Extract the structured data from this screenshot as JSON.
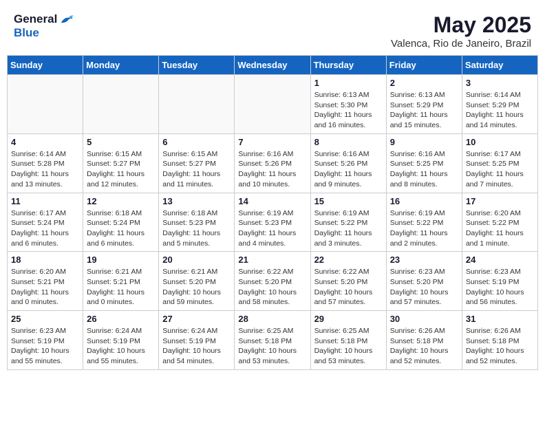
{
  "header": {
    "logo_general": "General",
    "logo_blue": "Blue",
    "month_title": "May 2025",
    "location": "Valenca, Rio de Janeiro, Brazil"
  },
  "weekdays": [
    "Sunday",
    "Monday",
    "Tuesday",
    "Wednesday",
    "Thursday",
    "Friday",
    "Saturday"
  ],
  "weeks": [
    [
      {
        "day": "",
        "info": ""
      },
      {
        "day": "",
        "info": ""
      },
      {
        "day": "",
        "info": ""
      },
      {
        "day": "",
        "info": ""
      },
      {
        "day": "1",
        "info": "Sunrise: 6:13 AM\nSunset: 5:30 PM\nDaylight: 11 hours\nand 16 minutes."
      },
      {
        "day": "2",
        "info": "Sunrise: 6:13 AM\nSunset: 5:29 PM\nDaylight: 11 hours\nand 15 minutes."
      },
      {
        "day": "3",
        "info": "Sunrise: 6:14 AM\nSunset: 5:29 PM\nDaylight: 11 hours\nand 14 minutes."
      }
    ],
    [
      {
        "day": "4",
        "info": "Sunrise: 6:14 AM\nSunset: 5:28 PM\nDaylight: 11 hours\nand 13 minutes."
      },
      {
        "day": "5",
        "info": "Sunrise: 6:15 AM\nSunset: 5:27 PM\nDaylight: 11 hours\nand 12 minutes."
      },
      {
        "day": "6",
        "info": "Sunrise: 6:15 AM\nSunset: 5:27 PM\nDaylight: 11 hours\nand 11 minutes."
      },
      {
        "day": "7",
        "info": "Sunrise: 6:16 AM\nSunset: 5:26 PM\nDaylight: 11 hours\nand 10 minutes."
      },
      {
        "day": "8",
        "info": "Sunrise: 6:16 AM\nSunset: 5:26 PM\nDaylight: 11 hours\nand 9 minutes."
      },
      {
        "day": "9",
        "info": "Sunrise: 6:16 AM\nSunset: 5:25 PM\nDaylight: 11 hours\nand 8 minutes."
      },
      {
        "day": "10",
        "info": "Sunrise: 6:17 AM\nSunset: 5:25 PM\nDaylight: 11 hours\nand 7 minutes."
      }
    ],
    [
      {
        "day": "11",
        "info": "Sunrise: 6:17 AM\nSunset: 5:24 PM\nDaylight: 11 hours\nand 6 minutes."
      },
      {
        "day": "12",
        "info": "Sunrise: 6:18 AM\nSunset: 5:24 PM\nDaylight: 11 hours\nand 6 minutes."
      },
      {
        "day": "13",
        "info": "Sunrise: 6:18 AM\nSunset: 5:23 PM\nDaylight: 11 hours\nand 5 minutes."
      },
      {
        "day": "14",
        "info": "Sunrise: 6:19 AM\nSunset: 5:23 PM\nDaylight: 11 hours\nand 4 minutes."
      },
      {
        "day": "15",
        "info": "Sunrise: 6:19 AM\nSunset: 5:22 PM\nDaylight: 11 hours\nand 3 minutes."
      },
      {
        "day": "16",
        "info": "Sunrise: 6:19 AM\nSunset: 5:22 PM\nDaylight: 11 hours\nand 2 minutes."
      },
      {
        "day": "17",
        "info": "Sunrise: 6:20 AM\nSunset: 5:22 PM\nDaylight: 11 hours\nand 1 minute."
      }
    ],
    [
      {
        "day": "18",
        "info": "Sunrise: 6:20 AM\nSunset: 5:21 PM\nDaylight: 11 hours\nand 0 minutes."
      },
      {
        "day": "19",
        "info": "Sunrise: 6:21 AM\nSunset: 5:21 PM\nDaylight: 11 hours\nand 0 minutes."
      },
      {
        "day": "20",
        "info": "Sunrise: 6:21 AM\nSunset: 5:20 PM\nDaylight: 10 hours\nand 59 minutes."
      },
      {
        "day": "21",
        "info": "Sunrise: 6:22 AM\nSunset: 5:20 PM\nDaylight: 10 hours\nand 58 minutes."
      },
      {
        "day": "22",
        "info": "Sunrise: 6:22 AM\nSunset: 5:20 PM\nDaylight: 10 hours\nand 57 minutes."
      },
      {
        "day": "23",
        "info": "Sunrise: 6:23 AM\nSunset: 5:20 PM\nDaylight: 10 hours\nand 57 minutes."
      },
      {
        "day": "24",
        "info": "Sunrise: 6:23 AM\nSunset: 5:19 PM\nDaylight: 10 hours\nand 56 minutes."
      }
    ],
    [
      {
        "day": "25",
        "info": "Sunrise: 6:23 AM\nSunset: 5:19 PM\nDaylight: 10 hours\nand 55 minutes."
      },
      {
        "day": "26",
        "info": "Sunrise: 6:24 AM\nSunset: 5:19 PM\nDaylight: 10 hours\nand 55 minutes."
      },
      {
        "day": "27",
        "info": "Sunrise: 6:24 AM\nSunset: 5:19 PM\nDaylight: 10 hours\nand 54 minutes."
      },
      {
        "day": "28",
        "info": "Sunrise: 6:25 AM\nSunset: 5:18 PM\nDaylight: 10 hours\nand 53 minutes."
      },
      {
        "day": "29",
        "info": "Sunrise: 6:25 AM\nSunset: 5:18 PM\nDaylight: 10 hours\nand 53 minutes."
      },
      {
        "day": "30",
        "info": "Sunrise: 6:26 AM\nSunset: 5:18 PM\nDaylight: 10 hours\nand 52 minutes."
      },
      {
        "day": "31",
        "info": "Sunrise: 6:26 AM\nSunset: 5:18 PM\nDaylight: 10 hours\nand 52 minutes."
      }
    ]
  ]
}
